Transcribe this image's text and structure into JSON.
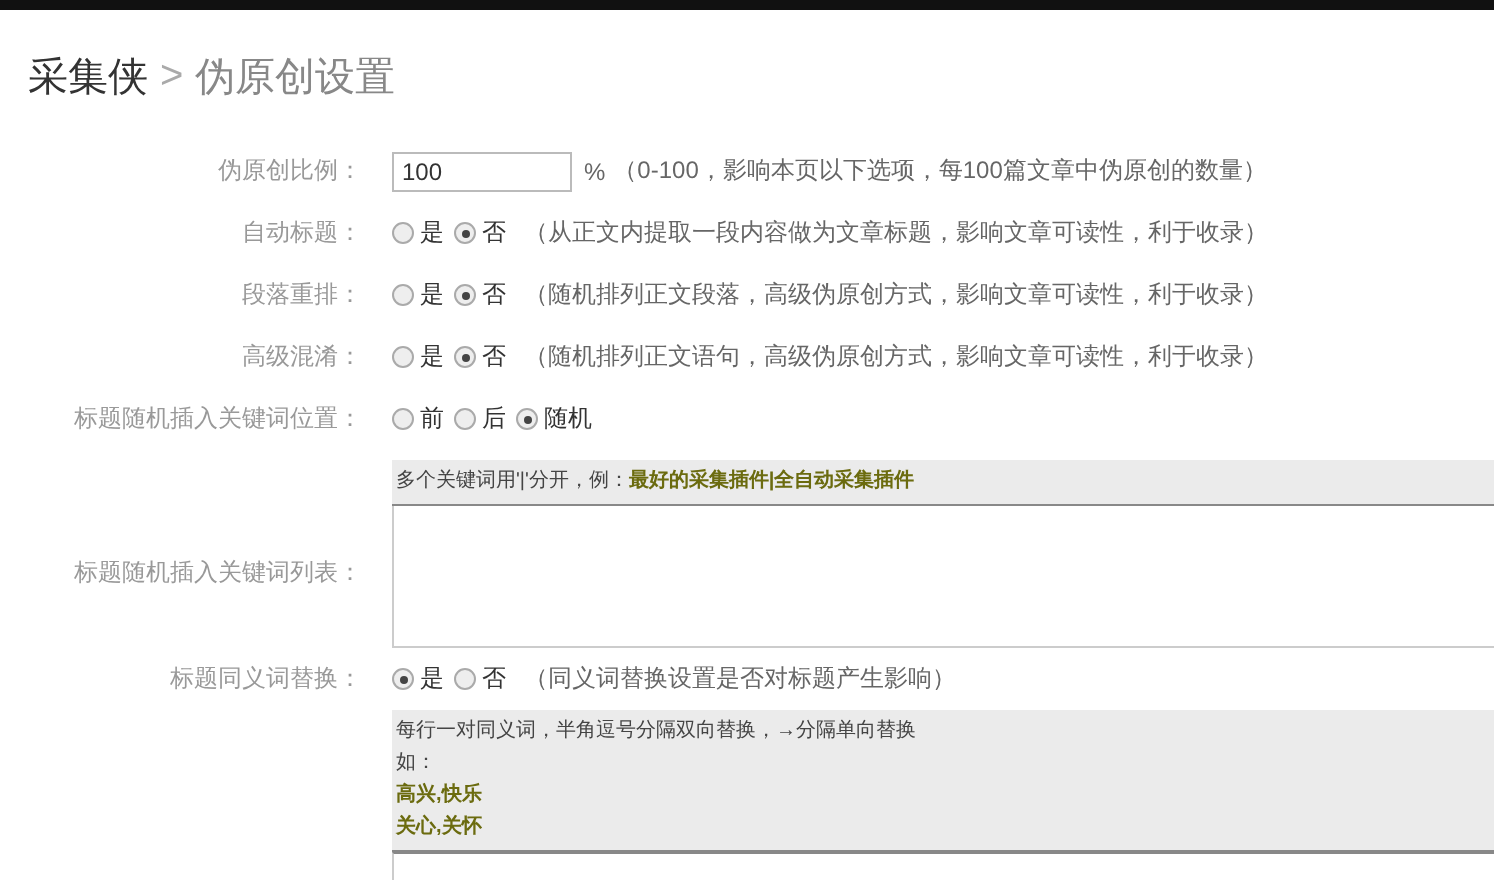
{
  "breadcrumb": {
    "site": "采集侠",
    "separator": ">",
    "page": "伪原创设置"
  },
  "fields": [
    {
      "kind": "number",
      "label": "伪原创比例：",
      "value": "100",
      "unit": "%",
      "note": "（0-100，影响本页以下选项，每100篇文章中伪原创的数量）"
    },
    {
      "kind": "radio",
      "label": "自动标题：",
      "options": [
        {
          "label": "是",
          "selected": false
        },
        {
          "label": "否",
          "selected": true
        }
      ],
      "note": "（从正文内提取一段内容做为文章标题，影响文章可读性，利于收录）"
    },
    {
      "kind": "radio",
      "label": "段落重排：",
      "options": [
        {
          "label": "是",
          "selected": false
        },
        {
          "label": "否",
          "selected": true
        }
      ],
      "note": "（随机排列正文段落，高级伪原创方式，影响文章可读性，利于收录）"
    },
    {
      "kind": "radio",
      "label": "高级混淆：",
      "options": [
        {
          "label": "是",
          "selected": false
        },
        {
          "label": "否",
          "selected": true
        }
      ],
      "note": "（随机排列正文语句，高级伪原创方式，影响文章可读性，利于收录）"
    },
    {
      "kind": "radio",
      "label": "标题随机插入关键词位置：",
      "options": [
        {
          "label": "前",
          "selected": false
        },
        {
          "label": "后",
          "selected": false
        },
        {
          "label": "随机",
          "selected": true
        }
      ]
    },
    {
      "kind": "textarea",
      "label": "标题随机插入关键词列表：",
      "hint_lines": [
        "多个关键词用'|'分开，例：**最好的采集插件|全自动采集插件**"
      ]
    },
    {
      "kind": "radio",
      "label": "标题同义词替换：",
      "options": [
        {
          "label": "是",
          "selected": true
        },
        {
          "label": "否",
          "selected": false
        }
      ],
      "note": "（同义词替换设置是否对标题产生影响）"
    },
    {
      "kind": "textarea",
      "hint_lines": [
        "每行一对同义词，半角逗号分隔双向替换，→分隔单向替换",
        "如："
      ],
      "examples": [
        "高兴,快乐",
        "关心,关怀"
      ]
    }
  ]
}
